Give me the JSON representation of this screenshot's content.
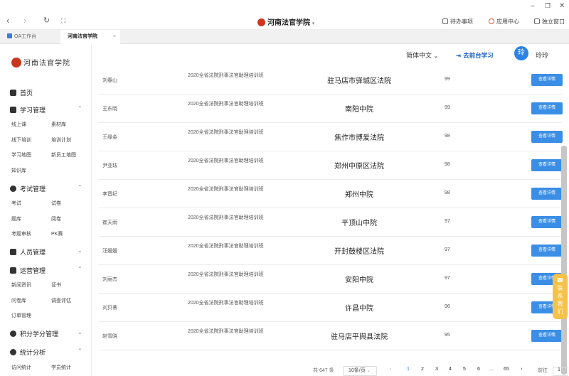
{
  "window": {
    "title": "河南法官学院",
    "actions": [
      "待办事项",
      "应用中心",
      "独立窗口"
    ]
  },
  "tabs": [
    {
      "label": "OA工作台"
    },
    {
      "label": "河南法官学院",
      "close": "×"
    }
  ],
  "sidebar": {
    "logo": "河南法官学院",
    "menu": [
      {
        "label": "首页"
      },
      {
        "label": "学习管理",
        "subs": [
          "线上课",
          "素材库",
          "线下培训",
          "培训计划",
          "学习地图",
          "新员工地图",
          "知识库"
        ]
      },
      {
        "label": "考试管理",
        "subs": [
          "考试",
          "试卷",
          "题库",
          "阅卷",
          "考题审核",
          "PK赛"
        ]
      },
      {
        "label": "人员管理"
      },
      {
        "label": "运营管理",
        "subs": [
          "新闻资讯",
          "证书",
          "问卷库",
          "调查评估",
          "订单管理"
        ]
      },
      {
        "label": "积分学分管理"
      },
      {
        "label": "统计分析",
        "subs": [
          "访问统计",
          "学员统计"
        ]
      }
    ]
  },
  "header": {
    "language": "简体中文",
    "front_link": "去前台学习",
    "avatar": "玲",
    "username": "玲玲"
  },
  "table": {
    "button_label": "查看详情",
    "rows": [
      {
        "name": "刘春山",
        "class_name": "2020全省法院刑事法官助理培训班",
        "court": "驻马店市驿城区法院",
        "score": "99"
      },
      {
        "name": "王东晓",
        "class_name": "2020全省法院刑事法官助理培训班",
        "court": "南阳中院",
        "score": "99"
      },
      {
        "name": "王缘金",
        "class_name": "2020全省法院刑事法官助理培训班",
        "court": "焦作市博爱法院",
        "score": "98"
      },
      {
        "name": "尹亚珐",
        "class_name": "2020全省法院刑事法官助理培训班",
        "court": "郑州中原区法院",
        "score": "98"
      },
      {
        "name": "李晋纪",
        "class_name": "2020全省法院刑事法官助理培训班",
        "court": "郑州中院",
        "score": "98"
      },
      {
        "name": "崔天雨",
        "class_name": "2020全省法院刑事法官助理培训班",
        "court": "平顶山中院",
        "score": "97"
      },
      {
        "name": "汪媛媛",
        "class_name": "2020全省法院刑事法官助理培训班",
        "court": "开封鼓楼区法院",
        "score": "97"
      },
      {
        "name": "刘丽杰",
        "class_name": "2020全省法院刑事法官助理培训班",
        "court": "安阳中院",
        "score": "97"
      },
      {
        "name": "刘贝蒂",
        "class_name": "2020全省法院刑事法官助理培训班",
        "court": "许昌中院",
        "score": "96"
      },
      {
        "name": "赵雪晓",
        "class_name": "2020全省法院刑事法官助理培训班",
        "court": "驻马店平舆县法院",
        "score": "95"
      }
    ]
  },
  "pagination": {
    "total": "共 647 条",
    "page_size": "10条/页",
    "pages": [
      "1",
      "2",
      "3",
      "4",
      "5",
      "6",
      "...",
      "65"
    ],
    "current": "1",
    "goto_label": "前往",
    "goto_value": "1"
  },
  "float_button": "联系我们"
}
